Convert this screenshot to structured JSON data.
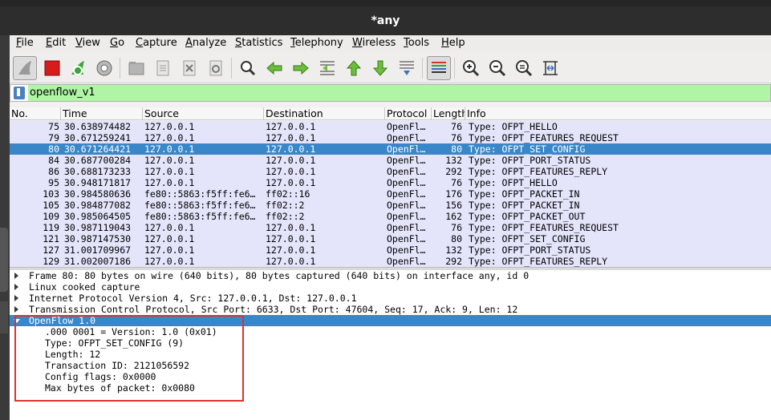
{
  "window": {
    "title": "*any"
  },
  "menu": [
    "File",
    "Edit",
    "View",
    "Go",
    "Capture",
    "Analyze",
    "Statistics",
    "Telephony",
    "Wireless",
    "Tools",
    "Help"
  ],
  "toolbar": {
    "icons": [
      "shark-fin-icon",
      "stop-icon",
      "restart-icon",
      "gear-icon",
      "open-folder-icon",
      "file-icon",
      "close-file-icon",
      "reload-icon",
      "search-icon",
      "arrow-left-icon",
      "arrow-right-icon",
      "go-to-packet-icon",
      "first-packet-icon",
      "last-packet-icon",
      "autoscroll-icon",
      "colorize-icon",
      "zoom-in-icon",
      "zoom-out-icon",
      "zoom-reset-icon",
      "resize-columns-icon"
    ]
  },
  "filter": {
    "value": "openflow_v1"
  },
  "packet_list": {
    "columns": [
      "No.",
      "Time",
      "Source",
      "Destination",
      "Protocol",
      "Length",
      "Info"
    ],
    "rows": [
      [
        "75",
        "30.638974482",
        "127.0.0.1",
        "127.0.0.1",
        "OpenFl…",
        "76",
        "Type: OFPT_HELLO"
      ],
      [
        "79",
        "30.671259241",
        "127.0.0.1",
        "127.0.0.1",
        "OpenFl…",
        "76",
        "Type: OFPT_FEATURES_REQUEST"
      ],
      [
        "80",
        "30.671264421",
        "127.0.0.1",
        "127.0.0.1",
        "OpenFl…",
        "80",
        "Type: OFPT_SET_CONFIG"
      ],
      [
        "84",
        "30.687700284",
        "127.0.0.1",
        "127.0.0.1",
        "OpenFl…",
        "132",
        "Type: OFPT_PORT_STATUS"
      ],
      [
        "86",
        "30.688173233",
        "127.0.0.1",
        "127.0.0.1",
        "OpenFl…",
        "292",
        "Type: OFPT_FEATURES_REPLY"
      ],
      [
        "95",
        "30.948171817",
        "127.0.0.1",
        "127.0.0.1",
        "OpenFl…",
        "76",
        "Type: OFPT_HELLO"
      ],
      [
        "103",
        "30.984580636",
        "fe80::5863:f5ff:fe6…",
        "ff02::16",
        "OpenFl…",
        "176",
        "Type: OFPT_PACKET_IN"
      ],
      [
        "105",
        "30.984877082",
        "fe80::5863:f5ff:fe6…",
        "ff02::2",
        "OpenFl…",
        "156",
        "Type: OFPT_PACKET_IN"
      ],
      [
        "109",
        "30.985064505",
        "fe80::5863:f5ff:fe6…",
        "ff02::2",
        "OpenFl…",
        "162",
        "Type: OFPT_PACKET_OUT"
      ],
      [
        "119",
        "30.987119043",
        "127.0.0.1",
        "127.0.0.1",
        "OpenFl…",
        "76",
        "Type: OFPT_FEATURES_REQUEST"
      ],
      [
        "121",
        "30.987147530",
        "127.0.0.1",
        "127.0.0.1",
        "OpenFl…",
        "80",
        "Type: OFPT_SET_CONFIG"
      ],
      [
        "127",
        "31.001709967",
        "127.0.0.1",
        "127.0.0.1",
        "OpenFl…",
        "132",
        "Type: OFPT_PORT_STATUS"
      ],
      [
        "129",
        "31.002007186",
        "127.0.0.1",
        "127.0.0.1",
        "OpenFl…",
        "292",
        "Type: OFPT_FEATURES_REPLY"
      ]
    ],
    "selected_row": 2
  },
  "details": {
    "frame": "Frame 80: 80 bytes on wire (640 bits), 80 bytes captured (640 bits) on interface any, id 0",
    "linux": "Linux cooked capture",
    "ip": "Internet Protocol Version 4, Src: 127.0.0.1, Dst: 127.0.0.1",
    "tcp": "Transmission Control Protocol, Src Port: 6633, Dst Port: 47604, Seq: 17, Ack: 9, Len: 12",
    "openflow": "OpenFlow 1.0",
    "fields": [
      ".000 0001 = Version: 1.0 (0x01)",
      "Type: OFPT_SET_CONFIG (9)",
      "Length: 12",
      "Transaction ID: 2121056592",
      "Config flags: 0x0000",
      "Max bytes of packet: 0x0080"
    ]
  },
  "colors": {
    "selection": "#3987c8",
    "filter_ok": "#b0f5a6",
    "highlight_box": "#e0302a",
    "row_bg": "#e4e4fb"
  }
}
